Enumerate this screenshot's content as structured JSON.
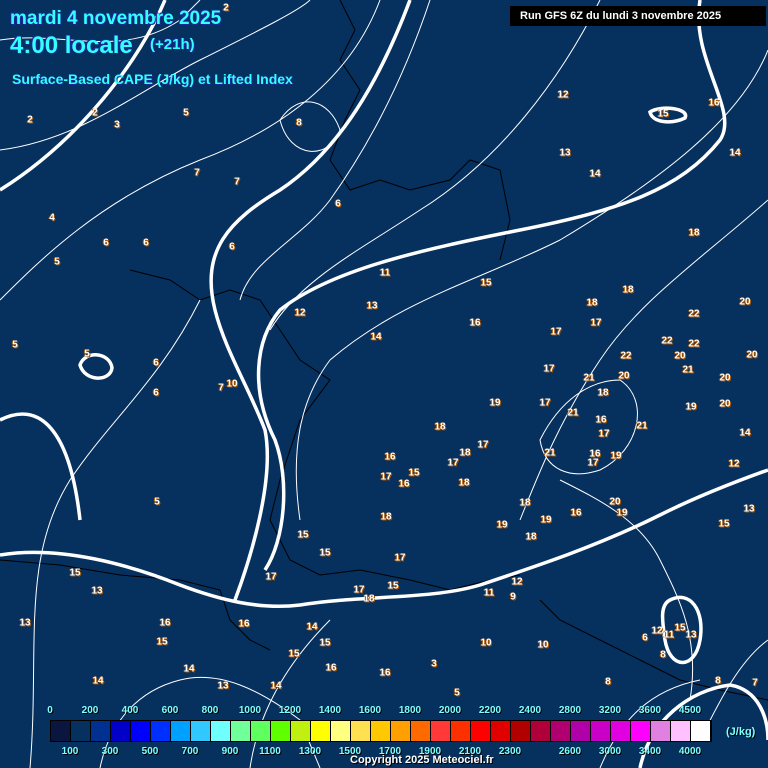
{
  "header": {
    "date": "mardi 4 novembre 2025",
    "time": "4:00 locale",
    "lead": "(+21h)",
    "parameter": "Surface-Based CAPE (J/kg) et Lifted Index",
    "run": "Run GFS 6Z du lundi 3 novembre 2025"
  },
  "colorbar": {
    "unit": "(J/kg)",
    "top_labels": [
      "0",
      "200",
      "400",
      "600",
      "800",
      "1000",
      "1200",
      "1400",
      "1600",
      "1800",
      "2000",
      "2200",
      "2400",
      "2800",
      "3200",
      "3600",
      "4500"
    ],
    "bottom_labels": [
      "100",
      "300",
      "500",
      "700",
      "900",
      "1100",
      "1300",
      "1500",
      "1700",
      "1900",
      "2100",
      "2300",
      "2600",
      "3000",
      "3400",
      "4000"
    ],
    "colors": [
      "#0a1540",
      "#06305e",
      "#003090",
      "#0000c8",
      "#0000ff",
      "#0030ff",
      "#00a0ff",
      "#30c8ff",
      "#70ffff",
      "#70ff98",
      "#60ff60",
      "#60ff00",
      "#c0f010",
      "#ffff00",
      "#ffff80",
      "#ffe050",
      "#ffc800",
      "#ffa000",
      "#ff6a00",
      "#ff3838",
      "#ff3000",
      "#ff0000",
      "#e00000",
      "#b00000",
      "#b0003a",
      "#b00070",
      "#b000a8",
      "#c800c8",
      "#e000e0",
      "#ff00ff",
      "#e080e0",
      "#ffc0ff",
      "#ffffff"
    ]
  },
  "lifted_index_labels": [
    "2",
    "2",
    "2",
    "3",
    "5",
    "8",
    "7",
    "7",
    "6",
    "4",
    "6",
    "6",
    "6",
    "5",
    "11",
    "15",
    "13",
    "12",
    "14",
    "16",
    "5",
    "5",
    "6",
    "6",
    "10",
    "7",
    "12",
    "15",
    "16",
    "13",
    "14",
    "14",
    "18",
    "18",
    "18",
    "17",
    "17",
    "22",
    "20",
    "22",
    "22",
    "22",
    "20",
    "20",
    "17",
    "21",
    "20",
    "21",
    "20",
    "19",
    "17",
    "21",
    "18",
    "16",
    "17",
    "21",
    "19",
    "20",
    "14",
    "18",
    "18",
    "17",
    "17",
    "16",
    "17",
    "15",
    "16",
    "18",
    "21",
    "16",
    "17",
    "19",
    "12",
    "5",
    "18",
    "18",
    "19",
    "19",
    "16",
    "20",
    "19",
    "18",
    "15",
    "13",
    "15",
    "15",
    "17",
    "15",
    "13",
    "17",
    "17",
    "18",
    "15",
    "12",
    "11",
    "9",
    "13",
    "16",
    "16",
    "14",
    "15",
    "15",
    "15",
    "10",
    "10",
    "6",
    "12",
    "15",
    "13",
    "11",
    "8",
    "14",
    "16",
    "16",
    "3",
    "14",
    "13",
    "14",
    "5",
    "8",
    "8",
    "7"
  ],
  "copyright": "Copyright 2025 Meteociel.fr",
  "background_color": "#06305e"
}
